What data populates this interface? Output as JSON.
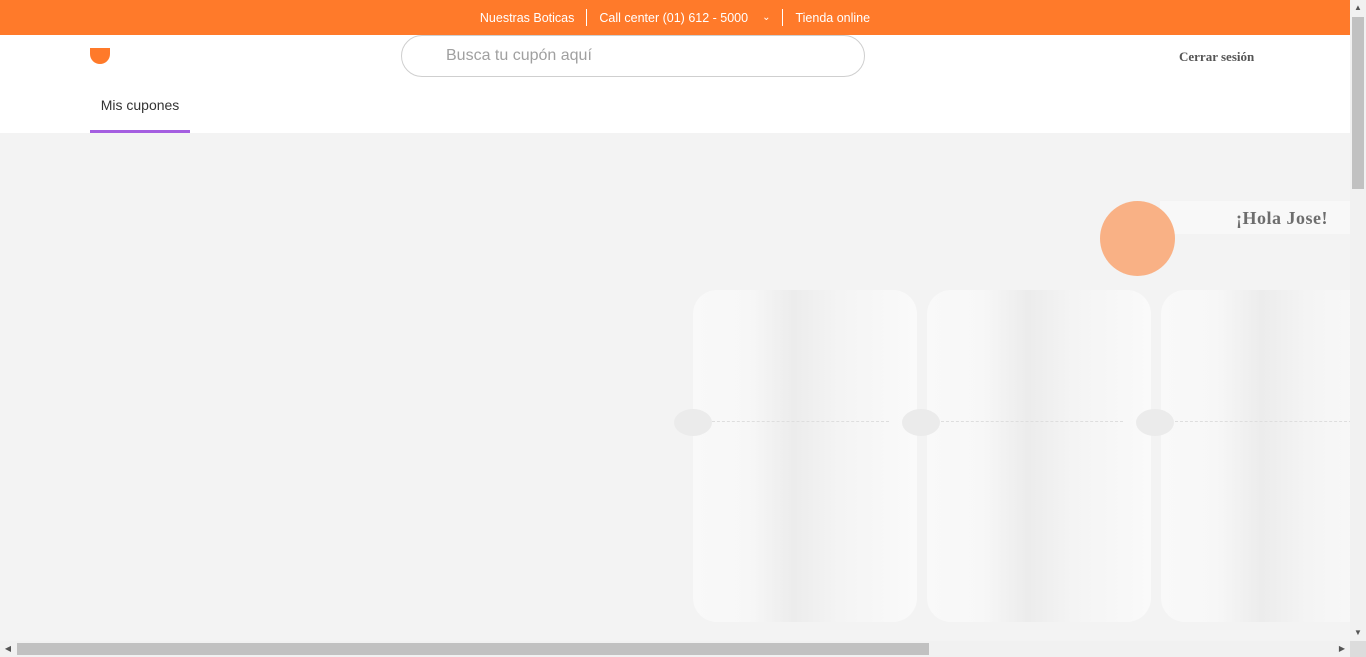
{
  "topbar": {
    "stores": "Nuestras Boticas",
    "call_center": "Call center (01) 612 - 5000",
    "online": "Tienda online",
    "chevron": "⌄"
  },
  "header": {
    "search_placeholder": "Busca tu cupón aquí",
    "logout": "Cerrar sesión"
  },
  "tabs": [
    {
      "label": "Mis cupones",
      "active": true
    }
  ],
  "greeting": "¡Hola Jose!",
  "colors": {
    "brand": "#ff7a2a",
    "tab_accent": "#a45ee0",
    "avatar": "#f9b185"
  }
}
